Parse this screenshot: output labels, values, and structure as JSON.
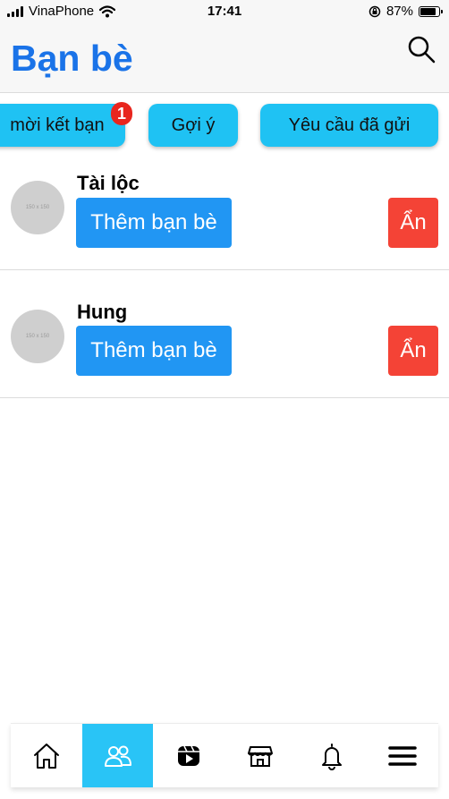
{
  "status_bar": {
    "carrier": "VinaPhone",
    "time": "17:41",
    "battery_percent": "87%",
    "battery_level": 0.87,
    "icons": [
      "signal-icon",
      "wifi-icon",
      "rotation-lock-icon",
      "battery-icon"
    ]
  },
  "header": {
    "title": "Bạn bè",
    "search_icon": "search-icon"
  },
  "tabs": [
    {
      "label": "mời kết bạn",
      "badge": "1"
    },
    {
      "label": "Gợi ý"
    },
    {
      "label": "Yêu cầu đã gửi"
    }
  ],
  "friends": [
    {
      "name": "Tài lộc",
      "avatar_text": "150 x 150",
      "add_label": "Thêm bạn bè",
      "hide_label": "Ẩn"
    },
    {
      "name": "Hung",
      "avatar_text": "150 x 150",
      "add_label": "Thêm bạn bè",
      "hide_label": "Ẩn"
    }
  ],
  "bottom_nav": [
    {
      "icon": "home-icon",
      "active": false
    },
    {
      "icon": "friends-icon",
      "active": true
    },
    {
      "icon": "video-icon",
      "active": false
    },
    {
      "icon": "marketplace-icon",
      "active": false
    },
    {
      "icon": "bell-icon",
      "active": false
    },
    {
      "icon": "menu-icon",
      "active": false
    }
  ],
  "colors": {
    "title_blue": "#1a73e8",
    "tab_cyan": "#1fc2f3",
    "add_button_blue": "#2196f3",
    "hide_button_red": "#f44336",
    "badge_red": "#e8261e",
    "nav_active": "#29c4f6"
  }
}
